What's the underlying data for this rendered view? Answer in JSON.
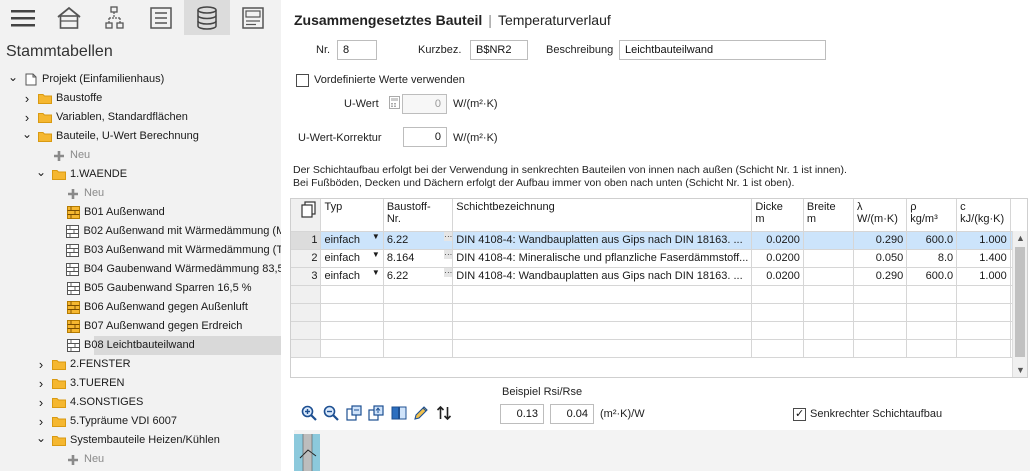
{
  "toolbar": {
    "icons": [
      "menu-icon",
      "building-icon",
      "network-icon",
      "list-icon",
      "database-icon",
      "form-icon"
    ],
    "active_index": 4
  },
  "left": {
    "title": "Stammtabellen",
    "tree": [
      {
        "label": "Projekt (Einfamilienhaus)",
        "level": 0,
        "chev": "open",
        "icon": "project"
      },
      {
        "label": "Baustoffe",
        "level": 1,
        "chev": "closed",
        "icon": "folder"
      },
      {
        "label": "Variablen, Standardflächen",
        "level": 1,
        "chev": "closed",
        "icon": "folder"
      },
      {
        "label": "Bauteile, U-Wert Berechnung",
        "level": 1,
        "chev": "open",
        "icon": "folder"
      },
      {
        "label": "Neu",
        "level": 2,
        "chev": "none",
        "icon": "plus"
      },
      {
        "label": "1.WAENDE",
        "level": 2,
        "chev": "open",
        "icon": "folder"
      },
      {
        "label": "Neu",
        "level": 3,
        "chev": "none",
        "icon": "plus"
      },
      {
        "label": "B01 Außenwand",
        "level": 3,
        "chev": "none",
        "icon": "wall-orange"
      },
      {
        "label": "B02 Außenwand mit Wärmedämmung (M",
        "level": 3,
        "chev": "none",
        "icon": "wall-gray"
      },
      {
        "label": "B03 Außenwand mit Wärmedämmung (T",
        "level": 3,
        "chev": "none",
        "icon": "wall-gray"
      },
      {
        "label": "B04 Gaubenwand Wärmedämmung 83,5",
        "level": 3,
        "chev": "none",
        "icon": "wall-gray"
      },
      {
        "label": "B05 Gaubenwand Sparren 16,5 %",
        "level": 3,
        "chev": "none",
        "icon": "wall-gray"
      },
      {
        "label": "B06 Außenwand gegen Außenluft",
        "level": 3,
        "chev": "none",
        "icon": "wall-orange"
      },
      {
        "label": "B07 Außenwand gegen Erdreich",
        "level": 3,
        "chev": "none",
        "icon": "wall-orange"
      },
      {
        "label": "B08 Leichtbauteilwand",
        "level": 3,
        "chev": "none",
        "icon": "wall-gray",
        "selected": true
      },
      {
        "label": "2.FENSTER",
        "level": 2,
        "chev": "closed",
        "icon": "folder"
      },
      {
        "label": "3.TUEREN",
        "level": 2,
        "chev": "closed",
        "icon": "folder"
      },
      {
        "label": "4.SONSTIGES",
        "level": 2,
        "chev": "closed",
        "icon": "folder"
      },
      {
        "label": "5.Typräume VDI 6007",
        "level": 2,
        "chev": "closed",
        "icon": "folder"
      },
      {
        "label": "Systembauteile Heizen/Kühlen",
        "level": 2,
        "chev": "open",
        "icon": "folder"
      },
      {
        "label": "Neu",
        "level": 3,
        "chev": "none",
        "icon": "plus"
      }
    ]
  },
  "header": {
    "title": "Zusammengesetztes Bauteil",
    "separator": "|",
    "subtitle": "Temperaturverlauf"
  },
  "form": {
    "nr_label": "Nr.",
    "nr_value": "8",
    "kurzbez_label": "Kurzbez.",
    "kurzbez_value": "B$NR2",
    "beschreibung_label": "Beschreibung",
    "beschreibung_value": "Leichtbauteilwand",
    "vordef_label": "Vordefinierte Werte verwenden",
    "vordef_checked": false,
    "uwert_label": "U-Wert",
    "uwert_value": "0",
    "uwert_unit": "W/(m²·K)",
    "korrektur_label": "U-Wert-Korrektur",
    "korrektur_value": "0",
    "korrektur_unit": "W/(m²·K)"
  },
  "info": {
    "line1": "Der Schichtaufbau erfolgt bei der Verwendung in senkrechten Bauteilen von innen nach außen (Schicht Nr. 1 ist innen).",
    "line2": "Bei Fußböden, Decken und Dächern erfolgt der Aufbau immer von oben nach unten (Schicht Nr. 1 ist oben)."
  },
  "grid": {
    "headers": {
      "typ": "Typ",
      "baustoff_1": "Baustoff-",
      "baustoff_2": "Nr.",
      "schicht": "Schichtbezeichnung",
      "dicke_1": "Dicke",
      "dicke_2": "m",
      "breite_1": "Breite",
      "breite_2": "m",
      "lambda_1": "λ",
      "lambda_2": "W/(m·K)",
      "rho_1": "ρ",
      "rho_2": "kg/m³",
      "c_1": "c",
      "c_2": "kJ/(kg·K)"
    },
    "rows": [
      {
        "nr": "1",
        "typ": "einfach",
        "baustoff": "6.22",
        "bez": "DIN 4108-4: Wandbauplatten aus Gips nach DIN 18163. ...",
        "dicke": "0.0200",
        "breite": "",
        "lambda": "0.290",
        "rho": "600.0",
        "c": "1.000"
      },
      {
        "nr": "2",
        "typ": "einfach",
        "baustoff": "8.164",
        "bez": "DIN 4108-4: Mineralische und pflanzliche Faserdämmstoff...",
        "dicke": "0.0200",
        "breite": "",
        "lambda": "0.050",
        "rho": "8.0",
        "c": "1.400"
      },
      {
        "nr": "3",
        "typ": "einfach",
        "baustoff": "6.22",
        "bez": "DIN 4108-4: Wandbauplatten aus Gips nach DIN 18163. ...",
        "dicke": "0.0200",
        "breite": "",
        "lambda": "0.290",
        "rho": "600.0",
        "c": "1.000"
      }
    ],
    "highlight_row": 0
  },
  "bottom": {
    "icons": [
      "zoom-in-icon",
      "zoom-out-icon",
      "copy-layer-icon",
      "paste-layer-icon",
      "book-icon",
      "edit-icon",
      "sort-icon"
    ],
    "beispiel_label": "Beispiel Rsi/Rse",
    "rsi_value": "0.13",
    "rse_value": "0.04",
    "rs_unit": "(m²·K)/W",
    "senkrecht_label": "Senkrechter Schichtaufbau",
    "senkrecht_checked": true
  }
}
